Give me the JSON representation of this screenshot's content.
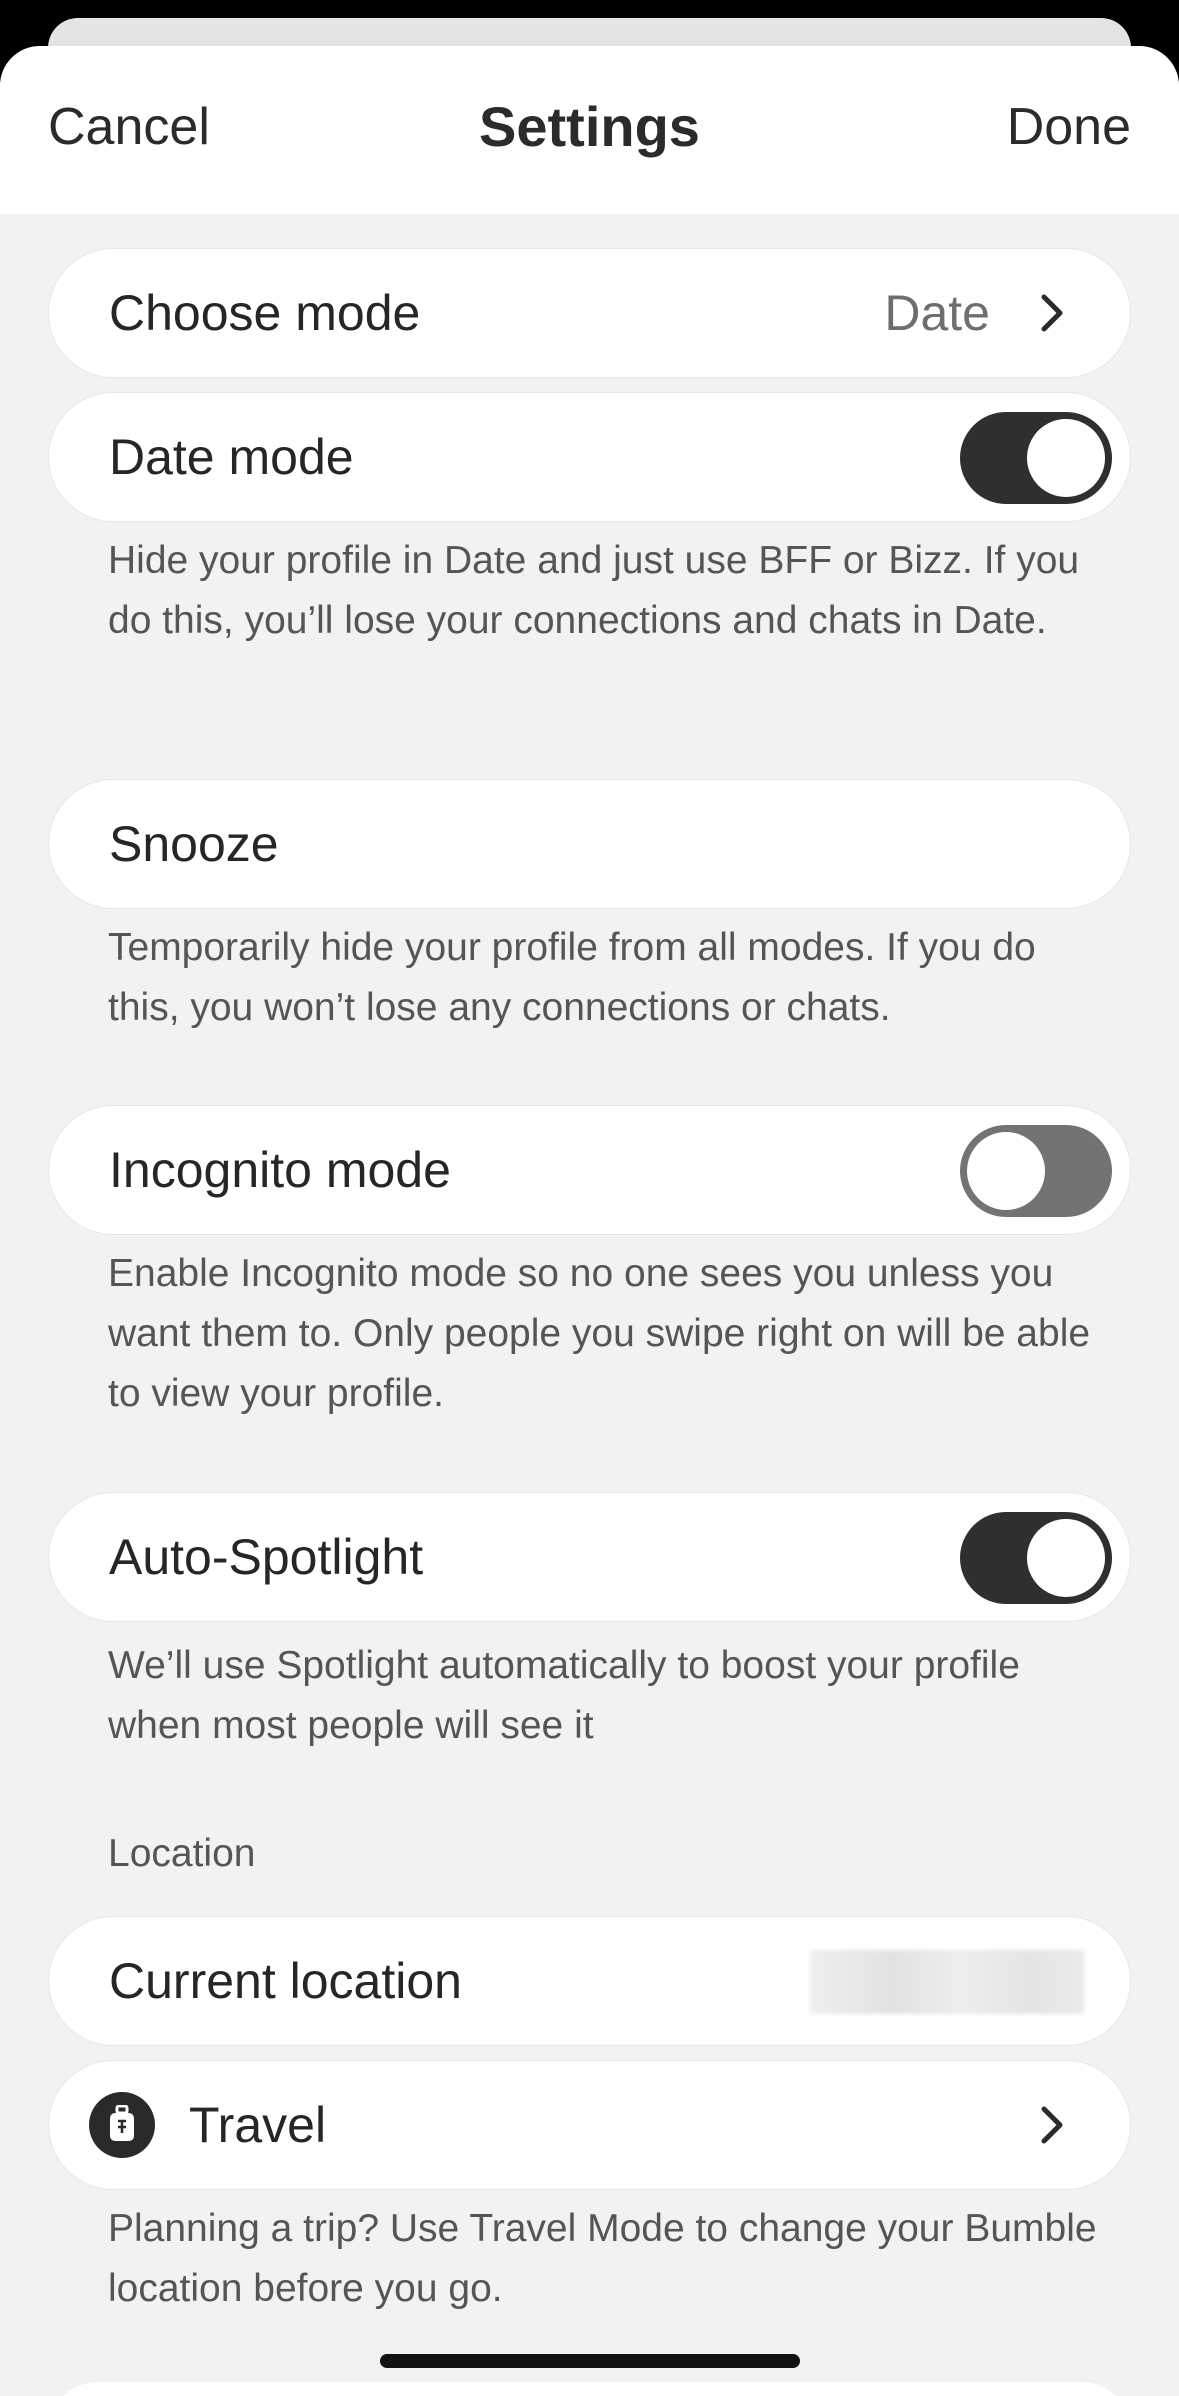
{
  "navbar": {
    "cancel_label": "Cancel",
    "title": "Settings",
    "done_label": "Done"
  },
  "choose_mode": {
    "label": "Choose mode",
    "value": "Date",
    "icon": "chevron-right-icon"
  },
  "date_mode": {
    "label": "Date mode",
    "toggle_on": true,
    "description": "Hide your profile in Date and just use BFF or Bizz. If you do this, you’ll lose your connections and chats in Date."
  },
  "snooze": {
    "label": "Snooze",
    "description": "Temporarily hide your profile from all modes. If you do this, you won’t lose any connections or chats."
  },
  "incognito_mode": {
    "label": "Incognito mode",
    "toggle_on": false,
    "description": "Enable Incognito mode so no one sees you unless you want them to. Only people you swipe right on will be able to view your profile."
  },
  "auto_spotlight": {
    "label": "Auto-Spotlight",
    "toggle_on": true,
    "description": "We’ll use Spotlight automatically to boost your profile when most people will see it"
  },
  "location": {
    "section_header": "Location",
    "current_location_label": "Current location",
    "travel_label": "Travel",
    "travel_icon": "suitcase-icon",
    "travel_description": "Planning a trip? Use Travel Mode to change your Bumble location before you go."
  },
  "colors": {
    "toggle_on": "#2f2f2f",
    "toggle_off": "#737373",
    "background": "#f2f2f2",
    "row": "#ffffff"
  }
}
